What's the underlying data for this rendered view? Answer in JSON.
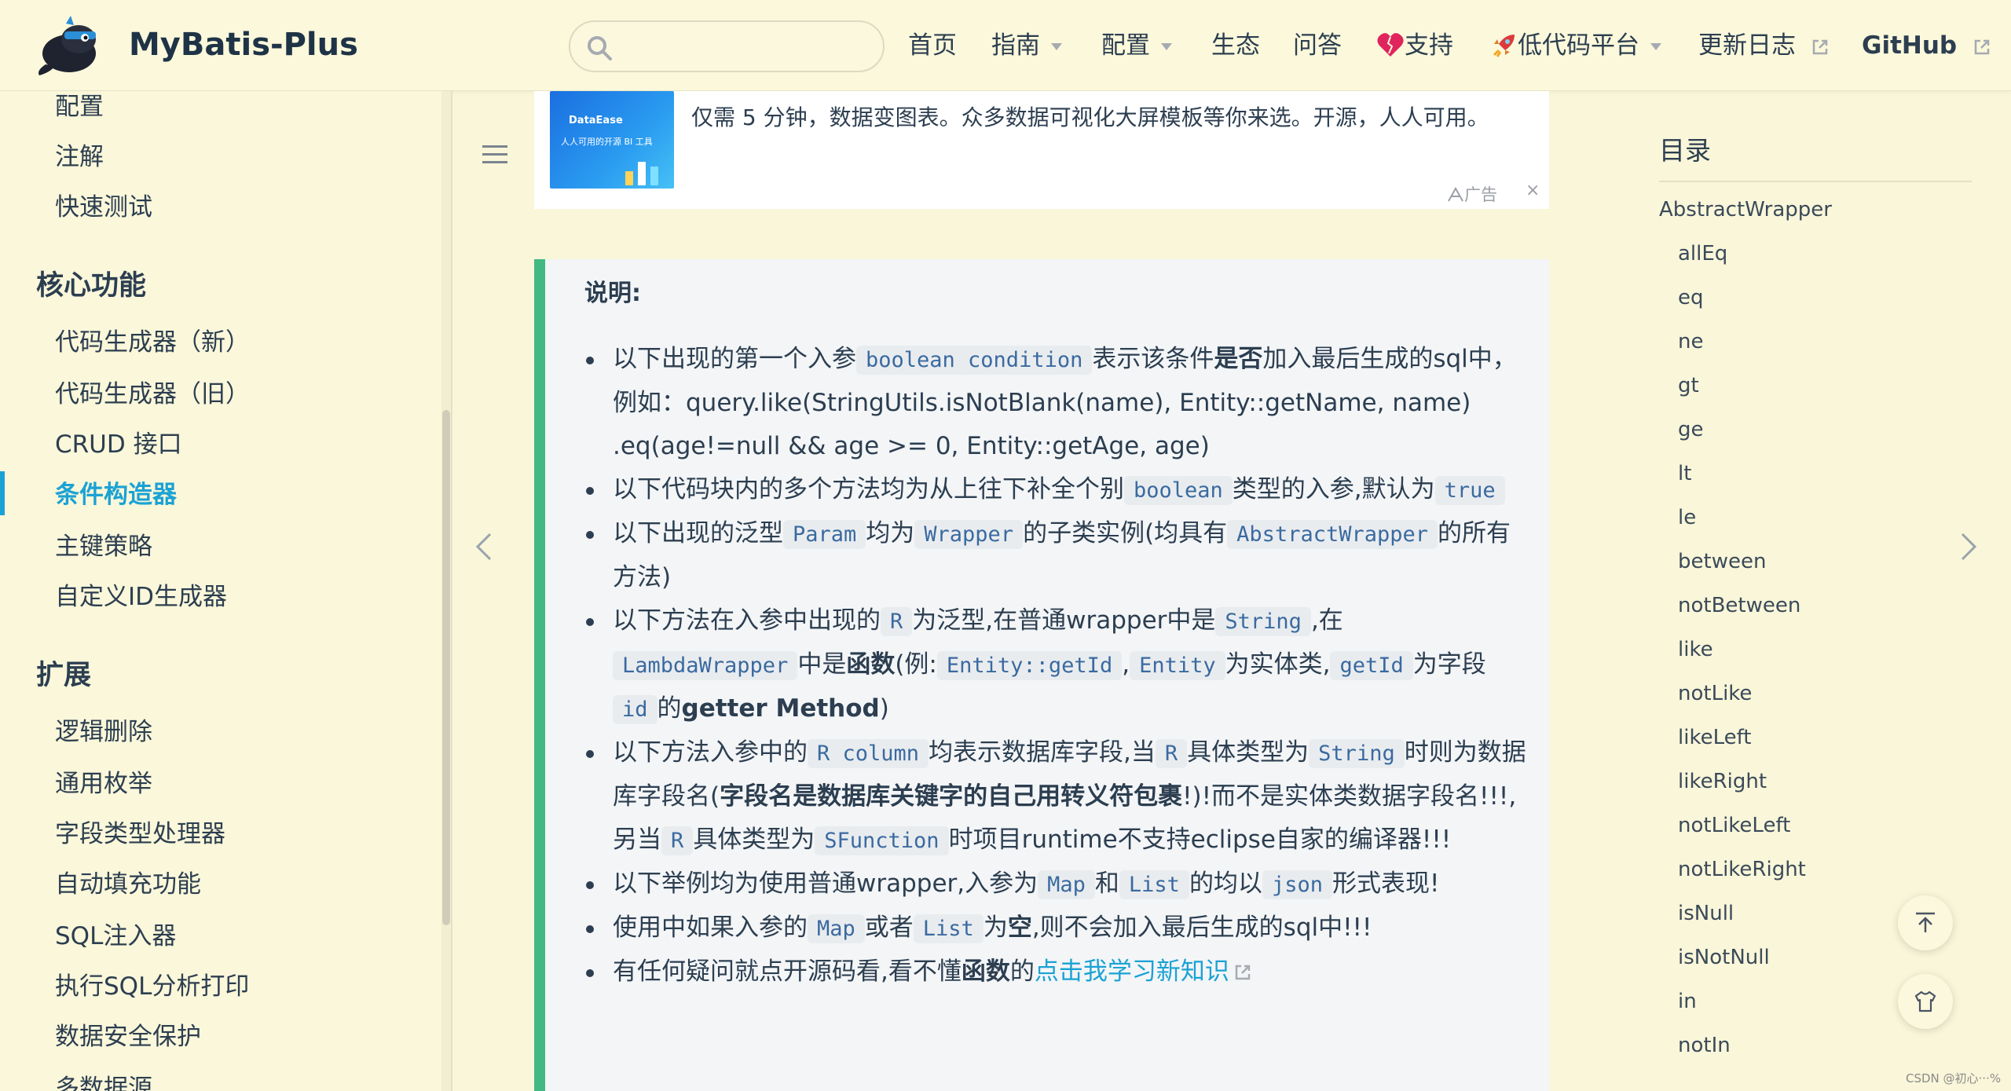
{
  "header": {
    "site_name": "MyBatis-Plus",
    "search_placeholder": "",
    "nav": {
      "home": "首页",
      "guide": "指南",
      "config": "配置",
      "ecosystem": "生态",
      "qa": "问答",
      "support": "支持",
      "lowcode": "低代码平台",
      "changelog": "更新日志",
      "github": "GitHub"
    }
  },
  "sidebar": {
    "top_items": [
      "配置",
      "注解",
      "快速测试"
    ],
    "group_core": "核心功能",
    "core_items": [
      "代码生成器（新）",
      "代码生成器（旧）",
      "CRUD 接口",
      "条件构造器",
      "主键策略",
      "自定义ID生成器"
    ],
    "active_item": "条件构造器",
    "group_ext": "扩展",
    "ext_items": [
      "逻辑删除",
      "通用枚举",
      "字段类型处理器",
      "自动填充功能",
      "SQL注入器",
      "执行SQL分析打印",
      "数据安全保护",
      "多数据源"
    ]
  },
  "ad": {
    "image_brand": "DataEase",
    "image_tagline": "人人可用的开源 BI 工具",
    "text": "仅需 5 分钟，数据变图表。众多数据可视化大屏模板等你来选。开源，人人可用。",
    "label": "广告",
    "close": "×"
  },
  "tip": {
    "title": "说明:",
    "b1": {
      "t1": "以下出现的第一个入参",
      "c1": "boolean condition",
      "t2": "表示该条件",
      "b": "是否",
      "t3": "加入最后生成的sql中，例如：query.like(StringUtils.isNotBlank(name), Entity::getName, name) .eq(age!=null && age >= 0, Entity::getAge, age)"
    },
    "b2": {
      "t1": "以下代码块内的多个方法均为从上往下补全个别",
      "c1": "boolean",
      "t2": "类型的入参,默认为",
      "c2": "true"
    },
    "b3": {
      "t1": "以下出现的泛型",
      "c1": "Param",
      "t2": "均为",
      "c2": "Wrapper",
      "t3": "的子类实例(均具有",
      "c3": "AbstractWrapper",
      "t4": "的所有方法)"
    },
    "b4": {
      "t1": "以下方法在入参中出现的",
      "c1": "R",
      "t2": "为泛型,在普通wrapper中是",
      "c2": "String",
      "t3": ",在",
      "c3": "LambdaWrapper",
      "t4": "中是",
      "b": "函数",
      "t5": "(例:",
      "c4": "Entity::getId",
      "t6": ",",
      "c5": "Entity",
      "t7": "为实体类,",
      "c6": "getId",
      "t8": "为字段",
      "c7": "id",
      "t9": "的",
      "b2": "getter Method",
      "t10": ")"
    },
    "b5": {
      "t1": "以下方法入参中的",
      "c1": "R column",
      "t2": "均表示数据库字段,当",
      "c2": "R",
      "t3": "具体类型为",
      "c3": "String",
      "t4": "时则为数据库字段名(",
      "b": "字段名是数据库关键字的自己用转义符包裹",
      "t5": "!)!而不是实体类数据字段名!!!,另当",
      "c4": "R",
      "t6": "具体类型为",
      "c5": "SFunction",
      "t7": "时项目runtime不支持eclipse自家的编译器!!!"
    },
    "b6": {
      "t1": "以下举例均为使用普通wrapper,入参为",
      "c1": "Map",
      "t2": "和",
      "c2": "List",
      "t3": "的均以",
      "c3": "json",
      "t4": "形式表现!"
    },
    "b7": {
      "t1": "使用中如果入参的",
      "c1": "Map",
      "t2": "或者",
      "c2": "List",
      "t3": "为",
      "b": "空",
      "t4": ",则不会加入最后生成的sql中!!!"
    },
    "b8": {
      "t1": "有任何疑问就点开源码看,看不懂",
      "b": "函数",
      "t2": "的",
      "link": "点击我学习新知识"
    }
  },
  "toc": {
    "title": "目录",
    "root": "AbstractWrapper",
    "items": [
      "allEq",
      "eq",
      "ne",
      "gt",
      "ge",
      "lt",
      "le",
      "between",
      "notBetween",
      "like",
      "notLike",
      "likeLeft",
      "likeRight",
      "notLikeLeft",
      "notLikeRight",
      "isNull",
      "isNotNull",
      "in",
      "notIn"
    ]
  },
  "watermark": "CSDN @初心···%",
  "colors": {
    "accent": "#1ba2d4",
    "tip_border": "#42b983",
    "page_bg": "#f9f6d9"
  }
}
